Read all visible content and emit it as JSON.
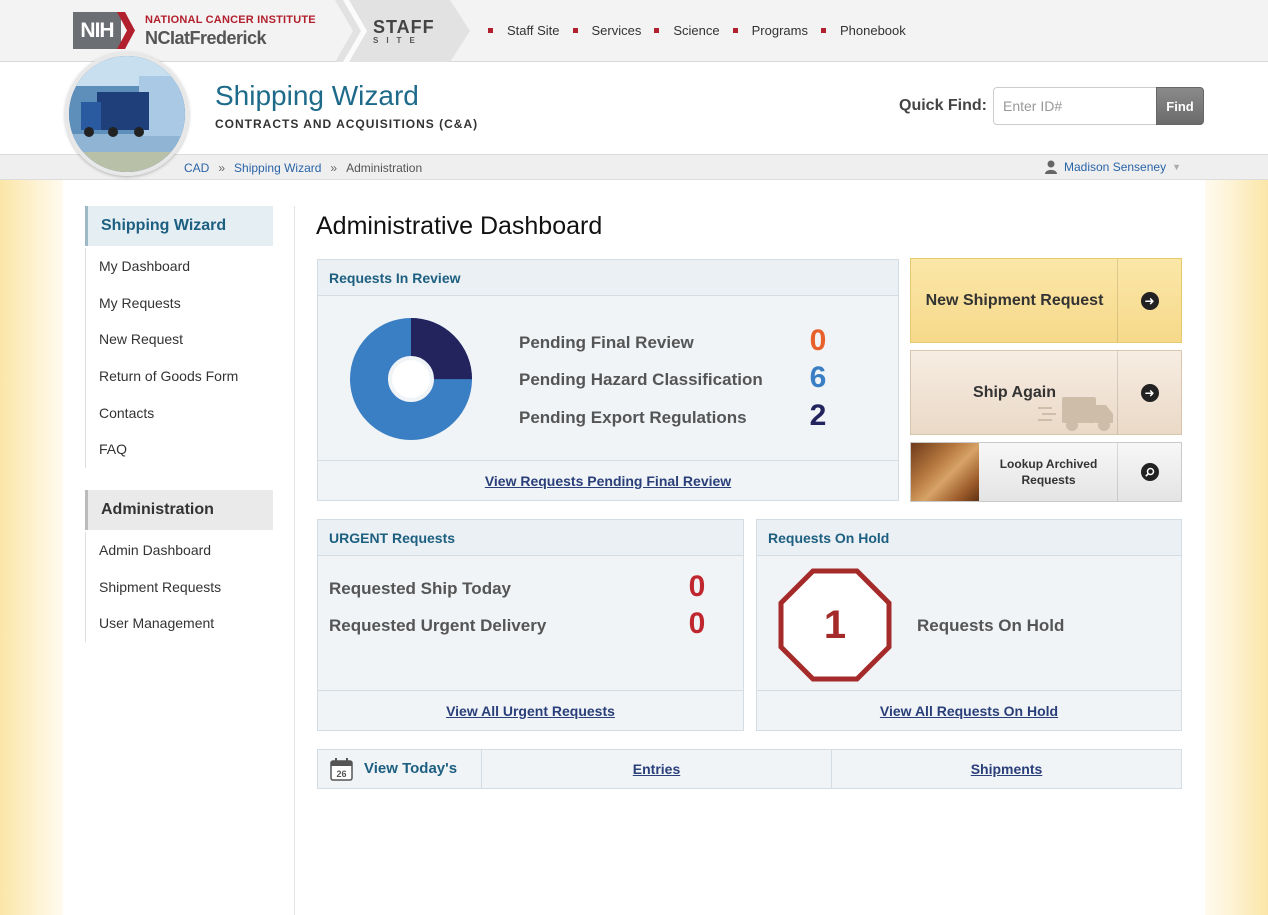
{
  "topbar": {
    "nih_badge": "NIH",
    "nci_line1": "NATIONAL CANCER INSTITUTE",
    "nci_line2": "NCIatFrederick",
    "staff_title": "STAFF",
    "staff_sub": "SITE",
    "nav": [
      "Staff Site",
      "Services",
      "Science",
      "Programs",
      "Phonebook"
    ]
  },
  "header": {
    "title": "Shipping Wizard",
    "subtitle": "CONTRACTS AND ACQUISITIONS (C&A)",
    "quick_find_label": "Quick Find:",
    "quick_find_placeholder": "Enter ID#",
    "find_button": "Find"
  },
  "breadcrumb": {
    "items": [
      "CAD",
      "Shipping Wizard",
      "Administration"
    ],
    "separator": "»",
    "user": "Madison Senseney"
  },
  "sidebar": {
    "section1_title": "Shipping Wizard",
    "section1_items": [
      "My Dashboard",
      "My Requests",
      "New Request",
      "Return of Goods Form",
      "Contacts",
      "FAQ"
    ],
    "section2_title": "Administration",
    "section2_items": [
      "Admin Dashboard",
      "Shipment Requests",
      "User Management"
    ]
  },
  "main": {
    "page_title": "Administrative Dashboard",
    "review": {
      "title": "Requests In Review",
      "rows": [
        {
          "label": "Pending Final Review",
          "value": "0",
          "color": "#e8612c"
        },
        {
          "label": "Pending Hazard Classification",
          "value": "6",
          "color": "#3a7fc4"
        },
        {
          "label": "Pending Export Regulations",
          "value": "2",
          "color": "#23235e"
        }
      ],
      "link": "View Requests Pending Final Review"
    },
    "urgent": {
      "title": "URGENT Requests",
      "rows": [
        {
          "label": "Requested Ship Today",
          "value": "0"
        },
        {
          "label": "Requested Urgent Delivery",
          "value": "0"
        }
      ],
      "link": "View All Urgent Requests"
    },
    "hold": {
      "title": "Requests On Hold",
      "count": "1",
      "label": "Requests On Hold",
      "link": "View All Requests On Hold"
    },
    "tiles": {
      "new_shipment": "New Shipment Request",
      "ship_again": "Ship Again",
      "lookup_archived": "Lookup Archived Requests"
    },
    "today": {
      "label": "View Today's",
      "calendar_day": "26",
      "entries": "Entries",
      "shipments": "Shipments"
    }
  },
  "colors": {
    "accent": "#1d6a8a",
    "urgent_red": "#c0262d",
    "hold_red": "#a52a2a",
    "donut_blue": "#3a7fc4",
    "donut_navy": "#23235e"
  }
}
